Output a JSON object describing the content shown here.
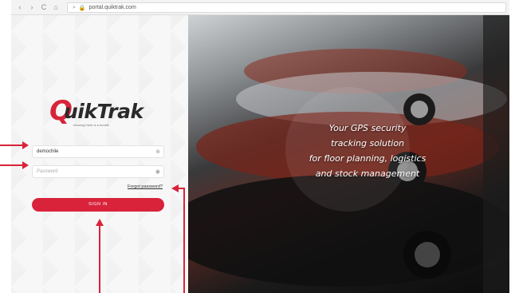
{
  "browser": {
    "nav_back": "‹",
    "nav_forward": "›",
    "nav_reload": "C",
    "nav_home": "⌂",
    "search_glyph": "⌕",
    "url_scheme": "",
    "url": "portal.quiktrak.com"
  },
  "login": {
    "logo_word": "uikTrak",
    "logo_letter": "Q",
    "logo_tagline": "knowing there is a trouble",
    "username_value": "demochile",
    "password_placeholder": "Password",
    "forgot_label": "Forgot password?",
    "signin_label": "SIGN IN"
  },
  "hero": {
    "line1": "Your GPS security",
    "line2": "tracking solution",
    "line3": "for floor planning, logistics",
    "line4": "and stock management"
  },
  "colors": {
    "brand_red": "#d8233a",
    "annotation_red": "#d8233a"
  }
}
